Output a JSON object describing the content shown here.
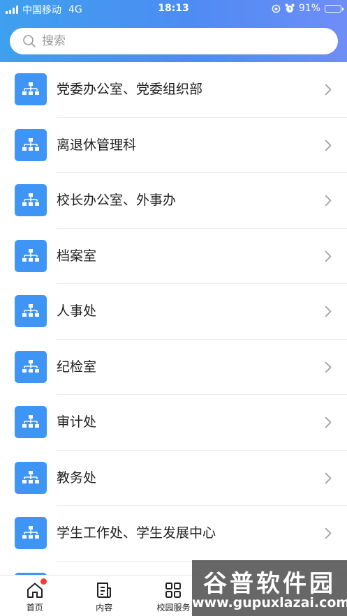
{
  "status_bar": {
    "carrier": "中国移动",
    "network": "4G",
    "time": "18:13",
    "battery_percent": "91%",
    "battery_level": 0.91
  },
  "search": {
    "placeholder": "搜索",
    "value": ""
  },
  "departments": [
    {
      "label": "党委办公室、党委组织部"
    },
    {
      "label": "离退休管理科"
    },
    {
      "label": "校长办公室、外事办"
    },
    {
      "label": "档案室"
    },
    {
      "label": "人事处"
    },
    {
      "label": "纪检室"
    },
    {
      "label": "审计处"
    },
    {
      "label": "教务处"
    },
    {
      "label": "学生工作处、学生发展中心"
    },
    {
      "label": ""
    }
  ],
  "tabbar": {
    "home": "首页",
    "content": "内容",
    "campus_services": "校园服务"
  },
  "watermark": {
    "title": "谷普软件园",
    "url": "www.gupuxlazai.com"
  },
  "colors": {
    "header_start": "#3ea0ee",
    "header_end": "#6f8df7",
    "item_icon_bg": "#3f95f5",
    "badge": "#ff3b30"
  },
  "icons": {
    "list_item": "org-chart-icon",
    "row_arrow": "chevron-right-icon",
    "tab_home": "home-icon",
    "tab_content": "document-icon",
    "tab_services": "grid-icon"
  }
}
